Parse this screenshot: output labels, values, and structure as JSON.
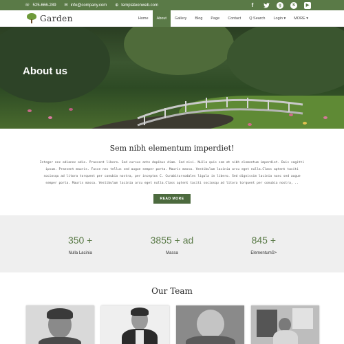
{
  "topbar": {
    "phone_icon": "phone-icon",
    "phone": "525-666-289",
    "email_icon": "envelope-icon",
    "email": "info@company.com",
    "web_icon": "globe-icon",
    "website": "templateonweb.com",
    "social": [
      "facebook-icon",
      "twitter-icon",
      "google-plus-icon",
      "skype-icon",
      "youtube-icon"
    ]
  },
  "nav": {
    "logo_text": "Garden",
    "items": [
      "Home",
      "About",
      "Gallery",
      "Blog",
      "Page",
      "Contact",
      "Q Search",
      "Login ▾",
      "MORE ▾"
    ],
    "active": "About"
  },
  "hero": {
    "title": "About us"
  },
  "intro": {
    "heading": "Sem nibh elementum imperdiet!",
    "body": "Integer nec odianec odio. Praesent libero. Sed cursus ante dapibus diam. Sed nisi. Nulla quis sem at nibh elementum imperdiet. Duis sagitti ipsum. Praesent mauris. Fusce nec tellus sed augue semper porta. Mauris massa. Vestibulum lacinia arcu eget nulla.Class aptent taciti sociosqu ad litora torquent per conubia nostra, per inceptos C. Curabitursodales ligula in libero. Sed dignissim lacinia nunc sed augue semper porta. Mauris massa. Vestibulum lacinia arcu eget nulla.Class aptent taciti sociosqu ad litora torquent per conubia nostra, ..",
    "button": "READ MORE"
  },
  "stats": [
    {
      "value": "350 +",
      "label": "Nulla Lacinia"
    },
    {
      "value": "3855 + ad",
      "label": "Massa"
    },
    {
      "value": "845 +",
      "label": "ElementumS>"
    }
  ],
  "team": {
    "heading": "Our Team"
  },
  "colors": {
    "accent": "#5a7a47",
    "stats_bg": "#efefef"
  }
}
